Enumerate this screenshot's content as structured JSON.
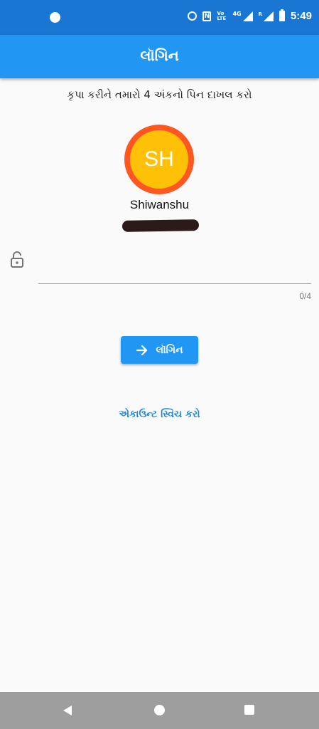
{
  "status_bar": {
    "time": "5:49",
    "nfc_label": "N",
    "volte_label": "Vo LTE",
    "network_label": "4G",
    "roaming_label": "R"
  },
  "app_bar": {
    "title": "લૉગિન"
  },
  "instruction": "કૃપા કરીને તમારો 4 અંકનો પિન દાખલ કરો",
  "profile": {
    "initials": "SH",
    "name": "Shiwanshu",
    "avatar_ring_color": "#ff5722",
    "avatar_fill_color": "#ffc107"
  },
  "pin_field": {
    "value": "",
    "placeholder": "",
    "counter": "0/4"
  },
  "login_button": {
    "label": "લૉગિન"
  },
  "switch_account_link": "એકાઉન્ટ સ્વિચ કરો",
  "colors": {
    "status_bar": "#1976d2",
    "primary": "#2196f3",
    "link": "#1e88e5",
    "nav_bar": "#9e9e9e"
  },
  "icons": {
    "lock": "lock-open-icon",
    "arrow": "arrow-right-icon",
    "nav_back": "back-icon",
    "nav_home": "home-icon",
    "nav_recent": "recent-apps-icon"
  }
}
